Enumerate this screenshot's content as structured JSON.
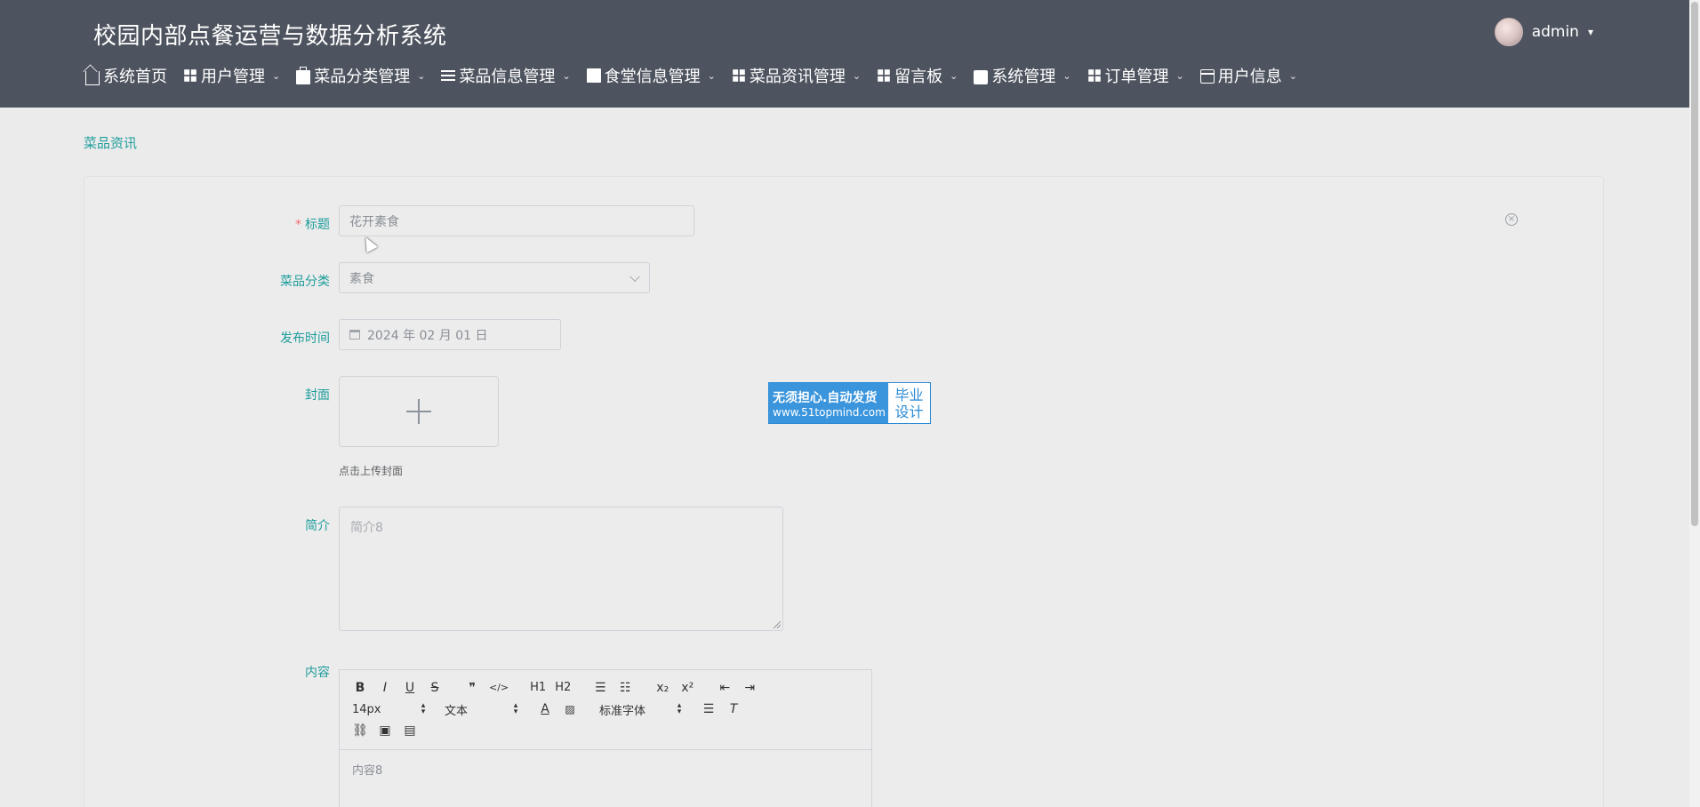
{
  "header": {
    "title": "校园内部点餐运营与数据分析系统",
    "user": {
      "name": "admin"
    }
  },
  "nav": {
    "items": [
      {
        "label": "系统首页",
        "icon": "home-icon",
        "has_dropdown": false
      },
      {
        "label": "用户管理",
        "icon": "grid-icon",
        "has_dropdown": true
      },
      {
        "label": "菜品分类管理",
        "icon": "briefcase-icon",
        "has_dropdown": true
      },
      {
        "label": "菜品信息管理",
        "icon": "list-icon",
        "has_dropdown": true
      },
      {
        "label": "食堂信息管理",
        "icon": "clipboard-icon",
        "has_dropdown": true
      },
      {
        "label": "菜品资讯管理",
        "icon": "grid-icon",
        "has_dropdown": true
      },
      {
        "label": "留言板",
        "icon": "grid-icon",
        "has_dropdown": true
      },
      {
        "label": "系统管理",
        "icon": "printer-icon",
        "has_dropdown": true
      },
      {
        "label": "订单管理",
        "icon": "grid-icon",
        "has_dropdown": true
      },
      {
        "label": "用户信息",
        "icon": "card-icon",
        "has_dropdown": true
      }
    ]
  },
  "breadcrumb": {
    "current": "菜品资讯"
  },
  "form": {
    "title": {
      "label": "标题",
      "required_mark": "*",
      "value": "花开素食"
    },
    "category": {
      "label": "菜品分类",
      "value": "素食"
    },
    "publish_time": {
      "label": "发布时间",
      "value": "2024 年 02 月 01 日"
    },
    "cover": {
      "label": "封面",
      "tip": "点击上传封面"
    },
    "summary": {
      "label": "简介",
      "placeholder": "简介8"
    },
    "content": {
      "label": "内容",
      "toolbar": {
        "row1": [
          "B",
          "I",
          "U",
          "S",
          "❞",
          "</>",
          "H1",
          "H2",
          "ol",
          "ul",
          "x₂",
          "x²",
          "⇤",
          "⇥"
        ],
        "font_size": "14px",
        "header_style": "文本",
        "font_family": "标准字体"
      },
      "placeholder": "内容8"
    }
  },
  "watermark": {
    "line1": "无须担心.自动发货",
    "line2": "www.51topmind.com",
    "right_line1": "毕业",
    "right_line2": "设计"
  },
  "colors": {
    "header_bg": "#4e545f",
    "accent": "#1f9d9d",
    "required": "#f56c6c",
    "page_bg": "#ebebeb"
  }
}
